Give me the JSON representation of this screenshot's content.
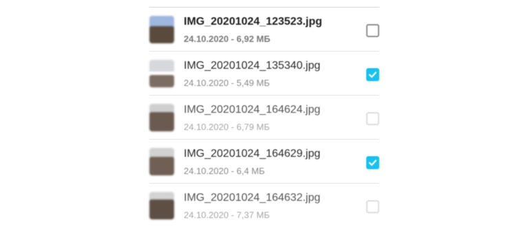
{
  "files": [
    {
      "name": "IMG_20201024_123523.jpg",
      "meta": "24.10.2020 - 6,92 МБ",
      "checked": false
    },
    {
      "name": "IMG_20201024_135340.jpg",
      "meta": "24.10.2020 - 5,49 МБ",
      "checked": true
    },
    {
      "name": "IMG_20201024_164624.jpg",
      "meta": "24.10.2020 - 6,79 МБ",
      "checked": false
    },
    {
      "name": "IMG_20201024_164629.jpg",
      "meta": "24.10.2020 - 6,4 МБ",
      "checked": true
    },
    {
      "name": "IMG_20201024_164632.jpg",
      "meta": "24.10.2020 - 7,37 МБ",
      "checked": false
    }
  ],
  "colors": {
    "accent": "#19c1ef",
    "text_primary": "#2a2a2a",
    "text_secondary": "#8a8a8a"
  },
  "icons": {
    "thumbnail": "photo-thumbnail",
    "checkbox": "checkbox-icon",
    "check": "check-icon"
  }
}
